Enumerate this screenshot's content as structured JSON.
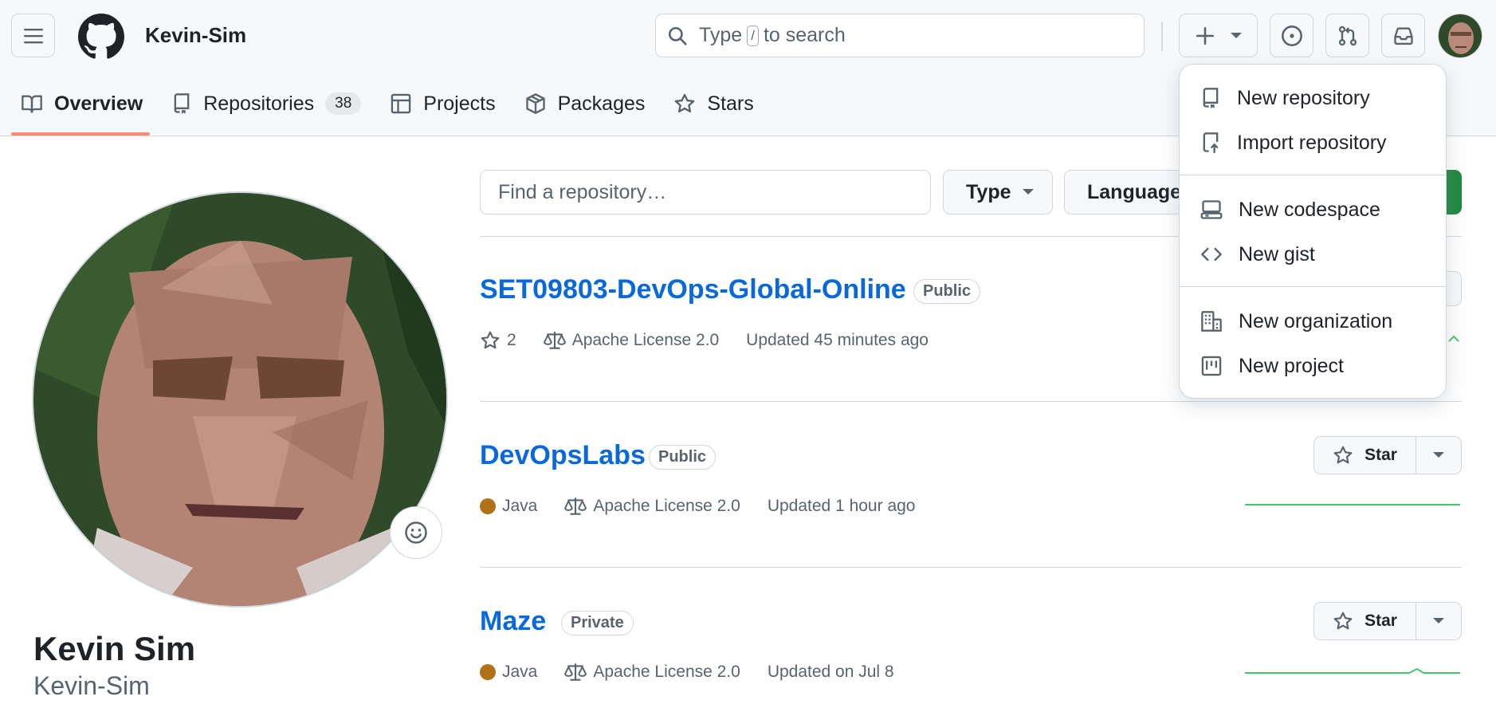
{
  "header": {
    "username": "Kevin-Sim",
    "search": {
      "prefix": "Type",
      "key": "/",
      "suffix": "to search"
    }
  },
  "tabs": [
    {
      "label": "Overview",
      "icon": "book-icon",
      "active": true
    },
    {
      "label": "Repositories",
      "icon": "repo-icon",
      "count": "38"
    },
    {
      "label": "Projects",
      "icon": "table-icon"
    },
    {
      "label": "Packages",
      "icon": "package-icon"
    },
    {
      "label": "Stars",
      "icon": "star-icon"
    }
  ],
  "profile": {
    "full_name": "Kevin Sim",
    "login": "Kevin-Sim"
  },
  "filters": {
    "find_placeholder": "Find a repository…",
    "type_label": "Type",
    "language_label": "Language"
  },
  "repos": [
    {
      "name": "SET09803-DevOps-Global-Online",
      "visibility": "Public",
      "stars": "2",
      "license": "Apache License 2.0",
      "updated": "Updated 45 minutes ago"
    },
    {
      "name": "DevOpsLabs",
      "visibility": "Public",
      "language": "Java",
      "language_color": "#b07219",
      "license": "Apache License 2.0",
      "updated": "Updated 1 hour ago",
      "star_label": "Star"
    },
    {
      "name": "Maze",
      "visibility": "Private",
      "language": "Java",
      "language_color": "#b07219",
      "license": "Apache License 2.0",
      "updated": "Updated on Jul 8",
      "star_label": "Star"
    }
  ],
  "create_menu": {
    "items": [
      {
        "label": "New repository",
        "icon": "repo-icon"
      },
      {
        "label": "Import repository",
        "icon": "repo-push-icon"
      },
      {
        "label": "New codespace",
        "icon": "codespaces-icon"
      },
      {
        "label": "New gist",
        "icon": "code-icon"
      },
      {
        "label": "New organization",
        "icon": "organization-icon"
      },
      {
        "label": "New project",
        "icon": "project-icon"
      }
    ]
  },
  "colors": {
    "accent": "#0969da",
    "tab_underline": "#fd8c73",
    "green": "#1f883d",
    "java": "#b07219",
    "spark": "#4ac26b"
  }
}
